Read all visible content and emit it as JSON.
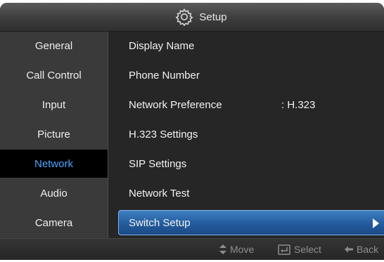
{
  "window": {
    "title": "Setup",
    "title_icon": "gear-icon"
  },
  "sidebar": {
    "items": [
      {
        "label": "General",
        "active": false
      },
      {
        "label": "Call Control",
        "active": false
      },
      {
        "label": "Input",
        "active": false
      },
      {
        "label": "Picture",
        "active": false
      },
      {
        "label": "Network",
        "active": true
      },
      {
        "label": "Audio",
        "active": false
      },
      {
        "label": "Camera",
        "active": false
      }
    ]
  },
  "menu": {
    "items": [
      {
        "label": "Display Name",
        "value": ""
      },
      {
        "label": "Phone Number",
        "value": ""
      },
      {
        "label": "Network Preference",
        "value": ": H.323"
      },
      {
        "label": "H.323 Settings",
        "value": ""
      },
      {
        "label": "SIP Settings",
        "value": ""
      },
      {
        "label": "Network Test",
        "value": ""
      },
      {
        "label": "Switch Setup",
        "value": "",
        "selected": true,
        "icon": "play-arrow-icon"
      }
    ]
  },
  "footer": {
    "hints": [
      {
        "icon": "up-down-arrow-icon",
        "label": "Move"
      },
      {
        "icon": "enter-key-icon",
        "label": "Select"
      },
      {
        "icon": "back-arrow-icon",
        "label": "Back"
      }
    ]
  },
  "colors": {
    "active_sidebar_text": "#4aa6ff",
    "selection_blue": "#22599a",
    "background": "#262626"
  }
}
